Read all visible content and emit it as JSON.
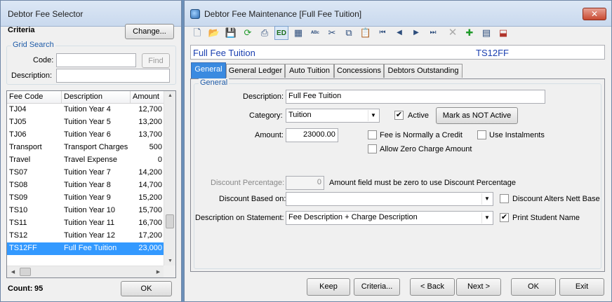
{
  "selector": {
    "title": "Debtor Fee Selector",
    "criteria_label": "Criteria",
    "change_button": "Change...",
    "grid_search": {
      "title": "Grid Search",
      "code_label": "Code:",
      "code_value": "",
      "find_button": "Find",
      "description_label": "Description:",
      "description_value": ""
    },
    "columns": [
      "Fee Code",
      "Description",
      "Amount"
    ],
    "rows": [
      {
        "code": "TJ04",
        "description": "Tuition Year 4",
        "amount": "12,700"
      },
      {
        "code": "TJ05",
        "description": "Tuition Year 5",
        "amount": "13,200"
      },
      {
        "code": "TJ06",
        "description": "Tuition Year 6",
        "amount": "13,700"
      },
      {
        "code": "Transport",
        "description": "Transport Charges",
        "amount": "500"
      },
      {
        "code": "Travel",
        "description": "Travel Expense",
        "amount": "0"
      },
      {
        "code": "TS07",
        "description": "Tuition Year 7",
        "amount": "14,200"
      },
      {
        "code": "TS08",
        "description": "Tuition Year 8",
        "amount": "14,700"
      },
      {
        "code": "TS09",
        "description": "Tuition Year 9",
        "amount": "15,200"
      },
      {
        "code": "TS10",
        "description": "Tuition Year 10",
        "amount": "15,700"
      },
      {
        "code": "TS11",
        "description": "Tuition Year 11",
        "amount": "16,700"
      },
      {
        "code": "TS12",
        "description": "Tuition Year 12",
        "amount": "17,200"
      },
      {
        "code": "TS12FF",
        "description": "Full Fee Tuition",
        "amount": "23,000"
      }
    ],
    "selected_row": 11,
    "count_label": "Count:",
    "count_value": "95",
    "ok_button": "OK"
  },
  "maintenance": {
    "title": "Debtor Fee Maintenance  [Full Fee Tuition]",
    "close_symbol": "✕",
    "record_name": "Full Fee Tuition",
    "record_code": "TS12FF",
    "toolbar_ed_label": "ED",
    "tabs": [
      "General",
      "General Ledger",
      "Auto Tuition",
      "Concessions",
      "Debtors Outstanding"
    ],
    "active_tab": "General",
    "general_group_title": "General",
    "fields": {
      "description_label": "Description:",
      "description_value": "Full Fee Tuition",
      "category_label": "Category:",
      "category_value": "Tuition",
      "active_label": "Active",
      "active_checked": true,
      "mark_not_active_button": "Mark as NOT Active",
      "amount_label": "Amount:",
      "amount_value": "23000.00",
      "fee_normally_credit_label": "Fee is Normally a Credit",
      "use_instalments_label": "Use Instalments",
      "allow_zero_label": "Allow Zero Charge Amount",
      "discount_percentage_label": "Discount Percentage:",
      "discount_percentage_value": "0",
      "discount_note": "Amount field must be zero to use Discount Percentage",
      "discount_based_on_label": "Discount Based on:",
      "discount_based_on_value": "",
      "discount_alters_label": "Discount Alters Nett Base",
      "description_on_statement_label": "Description on Statement:",
      "description_on_statement_value": "Fee Description + Charge Description",
      "print_student_name_label": "Print Student Name",
      "print_student_name_checked": true
    },
    "buttons": {
      "keep": "Keep",
      "criteria": "Criteria...",
      "back": "< Back",
      "next": "Next >",
      "ok": "OK",
      "exit": "Exit"
    }
  }
}
